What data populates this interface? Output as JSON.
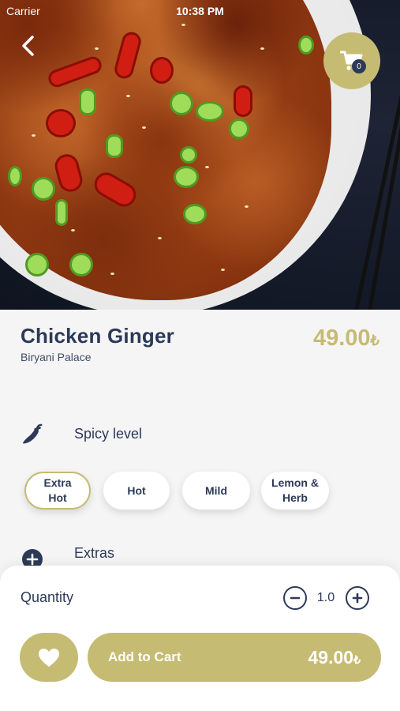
{
  "status_bar": {
    "carrier": "Carrier",
    "time": "10:38 PM"
  },
  "header": {
    "cart_count": "0"
  },
  "product": {
    "name": "Chicken Ginger",
    "restaurant": "Biryani Palace",
    "price": "49.00",
    "currency": "₺"
  },
  "spicy": {
    "label": "Spicy level",
    "options": [
      {
        "line1": "Extra",
        "line2": "Hot",
        "selected": true
      },
      {
        "line1": "Hot",
        "line2": "",
        "selected": false
      },
      {
        "line1": "Mild",
        "line2": "",
        "selected": false
      },
      {
        "line1": "Lemon &",
        "line2": "Herb",
        "selected": false
      }
    ]
  },
  "extras": {
    "label": "Extras"
  },
  "quantity": {
    "label": "Quantity",
    "value": "1.0"
  },
  "cart_action": {
    "label": "Add to Cart",
    "amount": "49.00",
    "currency": "₺"
  },
  "colors": {
    "accent": "#c6bb73",
    "text": "#2c3a57",
    "background": "#f5f5f5"
  },
  "icons": {
    "back": "chevron-left-icon",
    "cart": "shopping-cart-icon",
    "spicy": "chili-pepper-icon",
    "extras": "plus-circle-icon",
    "decrease": "minus-circle-icon",
    "increase": "plus-circle-icon",
    "favorite": "heart-icon"
  }
}
